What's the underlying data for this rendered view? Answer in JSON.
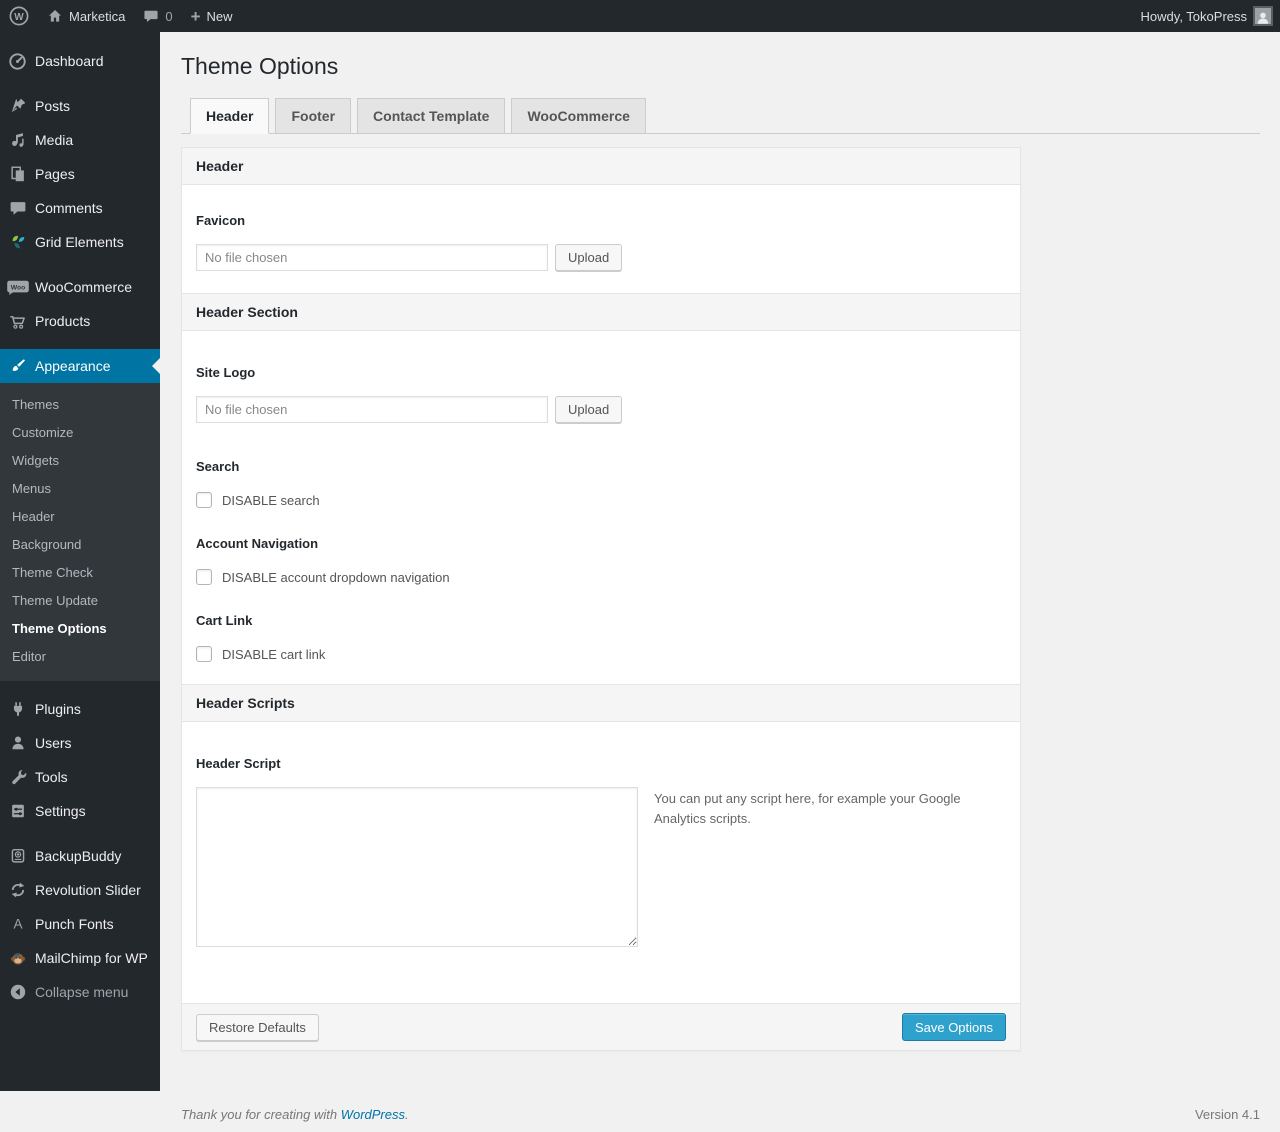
{
  "admin_bar": {
    "site_name": "Marketica",
    "comment_count": "0",
    "new_label": "New",
    "howdy": "Howdy, TokoPress",
    "wp_logo_letter": "W"
  },
  "icons": {
    "plus": "+"
  },
  "sidebar": {
    "top": [
      "Dashboard",
      "Posts",
      "Media",
      "Pages",
      "Comments",
      "Grid Elements"
    ],
    "commerce": [
      "WooCommerce",
      "Products"
    ],
    "woo_badge": "Woo",
    "appearance": {
      "label": "Appearance",
      "submenu": [
        "Themes",
        "Customize",
        "Widgets",
        "Menus",
        "Header",
        "Background",
        "Theme Check",
        "Theme Update",
        "Theme Options",
        "Editor"
      ]
    },
    "tools_group": [
      "Plugins",
      "Users",
      "Tools",
      "Settings"
    ],
    "plugins_group": [
      "BackupBuddy",
      "Revolution Slider",
      "Punch Fonts",
      "MailChimp for WP"
    ],
    "punch_letter": "A",
    "collapse_label": "Collapse menu"
  },
  "page": {
    "title": "Theme Options",
    "tabs": [
      {
        "label": "Header"
      },
      {
        "label": "Footer"
      },
      {
        "label": "Contact Template"
      },
      {
        "label": "WooCommerce"
      }
    ]
  },
  "panel": {
    "sections": {
      "header": {
        "bar": "Header"
      },
      "header_section": {
        "bar": "Header Section"
      },
      "header_scripts": {
        "bar": "Header Scripts"
      }
    },
    "fields": {
      "favicon": {
        "label": "Favicon",
        "value": "No file chosen",
        "button": "Upload"
      },
      "site_logo": {
        "label": "Site Logo",
        "value": "No file chosen",
        "button": "Upload"
      },
      "search": {
        "label": "Search",
        "checkbox": "DISABLE search"
      },
      "account_nav": {
        "label": "Account Navigation",
        "checkbox": "DISABLE account dropdown navigation"
      },
      "cart_link": {
        "label": "Cart Link",
        "checkbox": "DISABLE cart link"
      },
      "header_script": {
        "label": "Header Script",
        "hint": "You can put any script here, for example your Google Analytics scripts."
      }
    },
    "footer": {
      "restore": "Restore Defaults",
      "save": "Save Options"
    }
  },
  "footer": {
    "thanks_prefix": "Thank you for creating with ",
    "link": "WordPress",
    "suffix": ".",
    "version": "Version 4.1"
  },
  "colors": {
    "admin_dark": "#23282d",
    "submenu_bg": "#32373c",
    "accent": "#0074a2",
    "save_button": "#2ea2cc",
    "link": "#0073aa",
    "page_bg": "#f1f1f1"
  }
}
